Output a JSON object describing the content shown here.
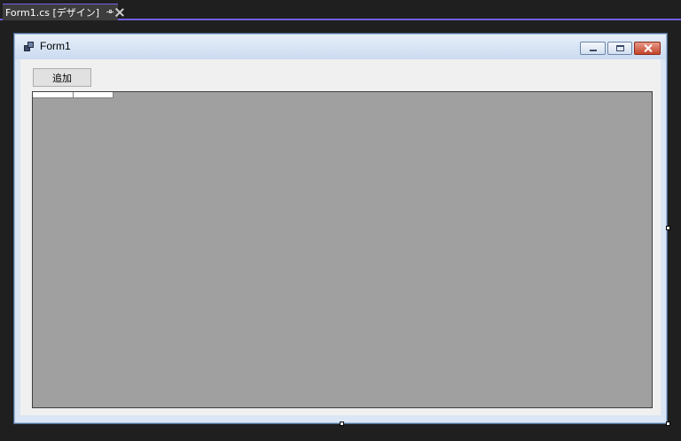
{
  "ide": {
    "tab": {
      "title": "Form1.cs [デザイン]",
      "pin_icon": "pin-icon",
      "close_icon": "close-icon"
    },
    "accent_color": "#7160e8"
  },
  "form": {
    "title": "Form1",
    "app_icon": "form-icon",
    "controls": {
      "minimize_icon": "minimize-icon",
      "maximize_icon": "maximize-icon",
      "close_icon": "close-icon"
    },
    "add_button_label": "追加",
    "grid": {
      "background_color": "#a0a0a0",
      "header_cells": [
        "",
        ""
      ]
    }
  }
}
